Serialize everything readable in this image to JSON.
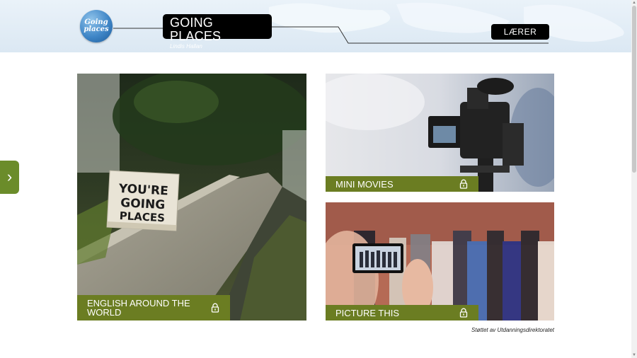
{
  "header": {
    "logo_line1": "Going",
    "logo_line2": "places",
    "title": "GOING PLACES",
    "author": "Lindis Hallan",
    "teacher_button": "LÆRER"
  },
  "side_tab": {
    "arrow": "›"
  },
  "cards": [
    {
      "label": "ENGLISH AROUND THE WORLD",
      "sign_text": "YOU'RE GOING PLACES",
      "icon": "lock-icon"
    },
    {
      "label": "MINI MOVIES",
      "icon": "lock-icon"
    },
    {
      "label": "PICTURE THIS",
      "icon": "lock-icon"
    }
  ],
  "footer": {
    "credit": "Støttet av Utdanningsdirektoratet"
  },
  "colors": {
    "accent_green": "#6b7d22",
    "tab_green": "#6b8c2a",
    "header_bg": "#dbe8f3"
  }
}
